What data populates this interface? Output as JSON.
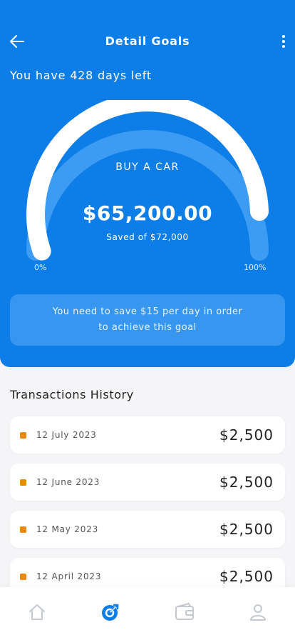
{
  "header": {
    "title": "Detail Goals",
    "back_icon": "arrow-left-icon",
    "more_icon": "more-vertical-icon"
  },
  "goal": {
    "days_left_text": "You have 428 days left",
    "name": "BUY A CAR",
    "saved_amount": "$65,200.00",
    "saved_of_text": "Saved of $72,000",
    "progress_fraction": 0.9056,
    "min_label": "0%",
    "max_label": "100%",
    "tip_line1": "You need to save $15 per day in order",
    "tip_line2": "to achieve this goal"
  },
  "transactions": {
    "title": "Transactions History",
    "items": [
      {
        "date": "12 July 2023",
        "amount": "$2,500"
      },
      {
        "date": "12 June 2023",
        "amount": "$2,500"
      },
      {
        "date": "12 May 2023",
        "amount": "$2,500"
      },
      {
        "date": "12 April 2023",
        "amount": "$2,500"
      }
    ]
  },
  "bottom_nav": {
    "items": [
      {
        "icon": "home-icon",
        "active": false
      },
      {
        "icon": "goal-target-icon",
        "active": true
      },
      {
        "icon": "wallet-icon",
        "active": false
      },
      {
        "icon": "profile-icon",
        "active": false
      }
    ]
  },
  "colors": {
    "primary": "#0d7de8",
    "tip_bg": "#3696f0",
    "accent_dot": "#e88a12",
    "nav_inactive": "#c4c8cf",
    "nav_active": "#0d7de8"
  }
}
